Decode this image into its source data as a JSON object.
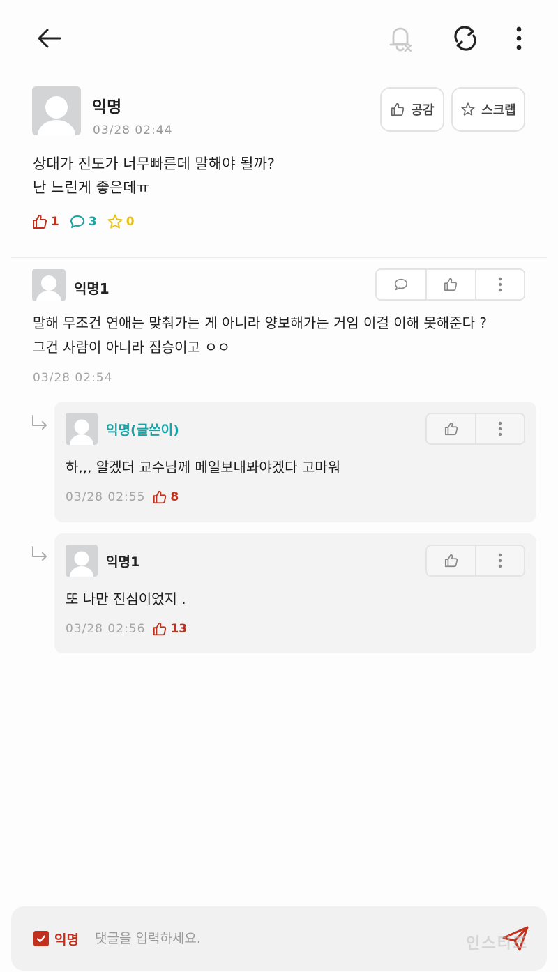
{
  "header": {
    "icons": [
      "back-arrow-icon",
      "bell-off-icon",
      "refresh-icon",
      "more-vertical-icon"
    ]
  },
  "post": {
    "author": "익명",
    "time": "03/28 02:44",
    "body": "상대가 진도가 너무빠른데 말해야 될까?\n난 느린게 좋은데ㅠ",
    "like_button_label": "공감",
    "scrap_button_label": "스크랩",
    "stats": {
      "likes": "1",
      "comments": "3",
      "scraps": "0"
    }
  },
  "comments": [
    {
      "author": "익명1",
      "body": "말해 무조건 연애는 맞춰가는 게 아니라 양보해가는 거임 이걸 이해 못해준다 ?\n그건 사람이 아니라 짐승이고 ㅇㅇ",
      "time": "03/28 02:54",
      "replies": [
        {
          "author": "익명(글쓴이)",
          "author_color": "#1aa3a6",
          "body": "하,,, 알겠더 교수님께 메일보내봐야겠다 고마워",
          "time": "03/28 02:55",
          "likes": "8"
        },
        {
          "author": "익명1",
          "author_color": "#222222",
          "body": "또 나만 진심이었지 .",
          "time": "03/28 02:56",
          "likes": "13"
        }
      ]
    }
  ],
  "input": {
    "anonymous_label": "익명",
    "anonymous_checked": true,
    "placeholder": "댓글을 입력하세요.",
    "value": ""
  },
  "watermark": "인스티즈",
  "colors": {
    "accent_red": "#c1311e",
    "teal": "#1aa3a6",
    "star_yellow": "#e8c21a"
  }
}
